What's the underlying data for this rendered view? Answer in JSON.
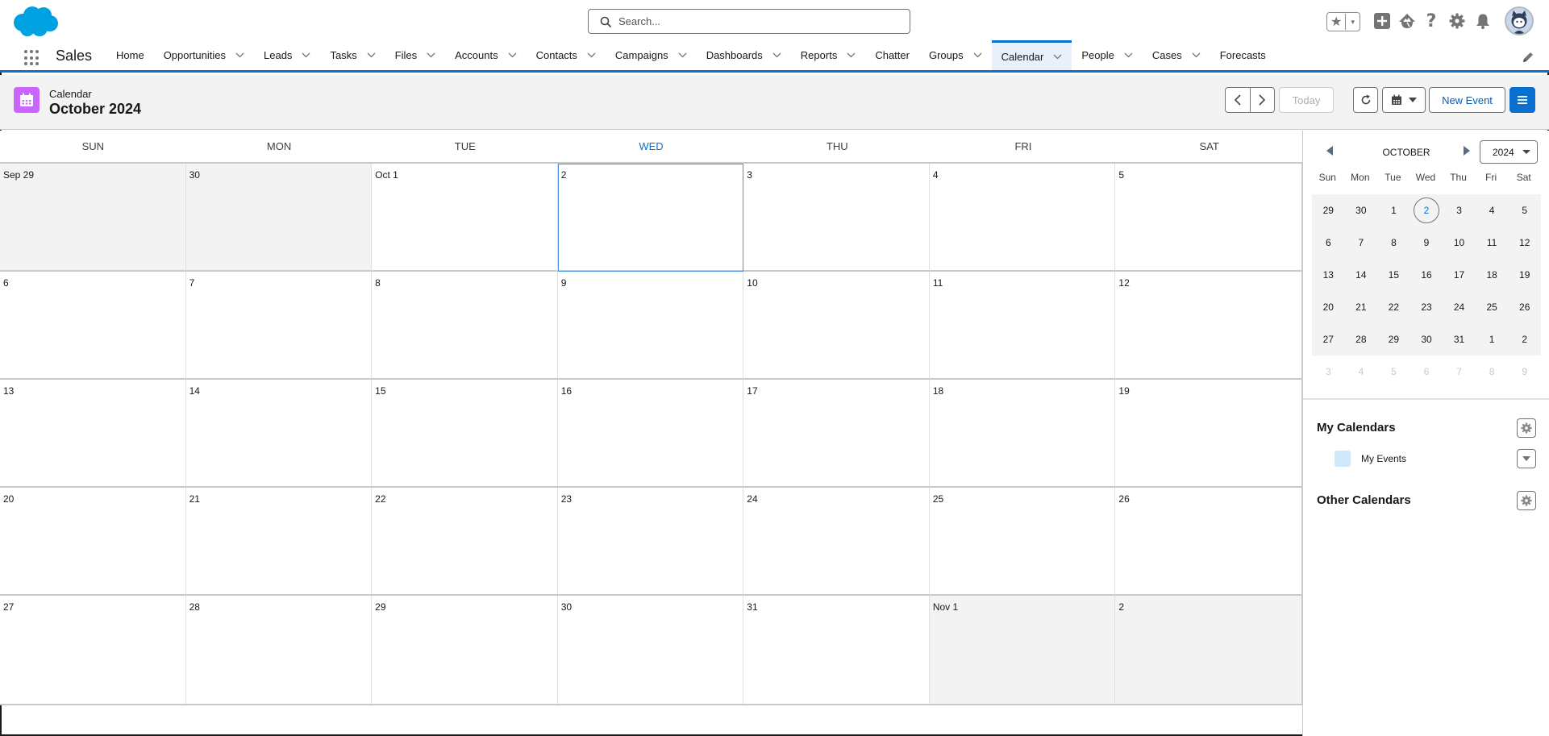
{
  "header": {
    "search_placeholder": "Search...",
    "utility_icons": [
      "favorites-star-icon",
      "favorites-dropdown-icon",
      "global-actions-icon",
      "trailhead-icon",
      "help-icon",
      "setup-gear-icon",
      "notifications-bell-icon",
      "user-avatar"
    ]
  },
  "nav": {
    "app_name": "Sales",
    "items": [
      {
        "label": "Home",
        "has_menu": false,
        "active": false
      },
      {
        "label": "Opportunities",
        "has_menu": true,
        "active": false
      },
      {
        "label": "Leads",
        "has_menu": true,
        "active": false
      },
      {
        "label": "Tasks",
        "has_menu": true,
        "active": false
      },
      {
        "label": "Files",
        "has_menu": true,
        "active": false
      },
      {
        "label": "Accounts",
        "has_menu": true,
        "active": false
      },
      {
        "label": "Contacts",
        "has_menu": true,
        "active": false
      },
      {
        "label": "Campaigns",
        "has_menu": true,
        "active": false
      },
      {
        "label": "Dashboards",
        "has_menu": true,
        "active": false
      },
      {
        "label": "Reports",
        "has_menu": true,
        "active": false
      },
      {
        "label": "Chatter",
        "has_menu": false,
        "active": false
      },
      {
        "label": "Groups",
        "has_menu": true,
        "active": false
      },
      {
        "label": "Calendar",
        "has_menu": true,
        "active": true
      },
      {
        "label": "People",
        "has_menu": true,
        "active": false
      },
      {
        "label": "Cases",
        "has_menu": true,
        "active": false
      },
      {
        "label": "Forecasts",
        "has_menu": false,
        "active": false
      }
    ]
  },
  "page_header": {
    "object_label": "Calendar",
    "title": "October 2024",
    "buttons": {
      "prev": "Previous",
      "next": "Next",
      "today": "Today",
      "refresh": "Refresh",
      "view": "Calendar view",
      "new_event": "New Event",
      "menu": "Calendars list"
    }
  },
  "calendar": {
    "days_of_week": [
      "SUN",
      "MON",
      "TUE",
      "WED",
      "THU",
      "FRI",
      "SAT"
    ],
    "today_dow_index": 3,
    "selected_cell_index": 3,
    "cells": [
      {
        "label": "Sep 29",
        "out": true
      },
      {
        "label": "30",
        "out": true
      },
      {
        "label": "Oct 1",
        "out": false
      },
      {
        "label": "2",
        "out": false
      },
      {
        "label": "3",
        "out": false
      },
      {
        "label": "4",
        "out": false
      },
      {
        "label": "5",
        "out": false
      },
      {
        "label": "6",
        "out": false
      },
      {
        "label": "7",
        "out": false
      },
      {
        "label": "8",
        "out": false
      },
      {
        "label": "9",
        "out": false
      },
      {
        "label": "10",
        "out": false
      },
      {
        "label": "11",
        "out": false
      },
      {
        "label": "12",
        "out": false
      },
      {
        "label": "13",
        "out": false
      },
      {
        "label": "14",
        "out": false
      },
      {
        "label": "15",
        "out": false
      },
      {
        "label": "16",
        "out": false
      },
      {
        "label": "17",
        "out": false
      },
      {
        "label": "18",
        "out": false
      },
      {
        "label": "19",
        "out": false
      },
      {
        "label": "20",
        "out": false
      },
      {
        "label": "21",
        "out": false
      },
      {
        "label": "22",
        "out": false
      },
      {
        "label": "23",
        "out": false
      },
      {
        "label": "24",
        "out": false
      },
      {
        "label": "25",
        "out": false
      },
      {
        "label": "26",
        "out": false
      },
      {
        "label": "27",
        "out": false
      },
      {
        "label": "28",
        "out": false
      },
      {
        "label": "29",
        "out": false
      },
      {
        "label": "30",
        "out": false
      },
      {
        "label": "31",
        "out": false
      },
      {
        "label": "Nov 1",
        "out": true
      },
      {
        "label": "2",
        "out": true
      }
    ]
  },
  "mini_calendar": {
    "month": "OCTOBER",
    "year": "2024",
    "days_of_week": [
      "Sun",
      "Mon",
      "Tue",
      "Wed",
      "Thu",
      "Fri",
      "Sat"
    ],
    "today_index": 3,
    "shaded_count": 35,
    "days": [
      "29",
      "30",
      "1",
      "2",
      "3",
      "4",
      "5",
      "6",
      "7",
      "8",
      "9",
      "10",
      "11",
      "12",
      "13",
      "14",
      "15",
      "16",
      "17",
      "18",
      "19",
      "20",
      "21",
      "22",
      "23",
      "24",
      "25",
      "26",
      "27",
      "28",
      "29",
      "30",
      "31",
      "1",
      "2",
      "3",
      "4",
      "5",
      "6",
      "7",
      "8",
      "9"
    ]
  },
  "my_calendars": {
    "title": "My Calendars",
    "items": [
      {
        "label": "My Events",
        "color": "#cfe9fb"
      }
    ]
  },
  "other_calendars": {
    "title": "Other Calendars"
  },
  "colors": {
    "brand": "#0b6fd0",
    "calendar_icon": "#cb65ff",
    "logo": "#00a1e0"
  }
}
